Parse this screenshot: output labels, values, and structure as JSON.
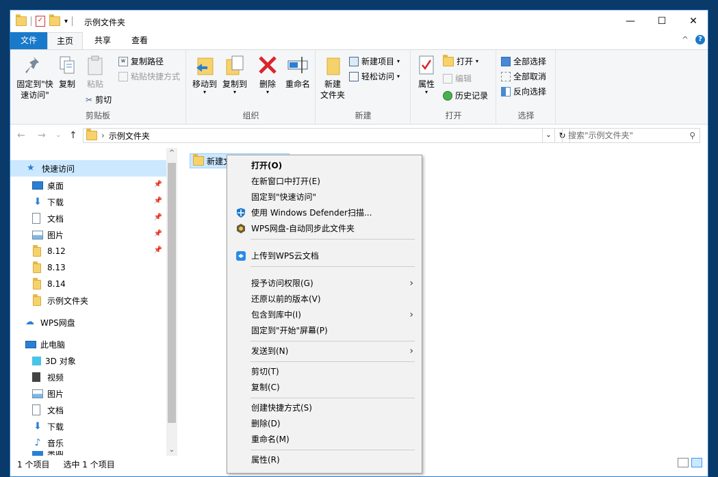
{
  "window": {
    "title": "示例文件夹",
    "qat_dropdown": "▾",
    "minimize": "—",
    "maximize": "☐",
    "close": "✕"
  },
  "tabs": {
    "file": "文件",
    "home": "主页",
    "share": "共享",
    "view": "查看",
    "collapse": "^",
    "help": "?"
  },
  "ribbon": {
    "clipboard": {
      "label": "剪贴板",
      "pin_quick": "固定到\"快速访问\"",
      "copy": "复制",
      "paste": "粘贴",
      "copy_path": "复制路径",
      "paste_shortcut": "粘贴快捷方式",
      "cut": "剪切"
    },
    "organize": {
      "label": "组织",
      "move_to": "移动到",
      "copy_to": "复制到",
      "delete": "删除",
      "rename": "重命名"
    },
    "new": {
      "label": "新建",
      "new_folder": "新建\n文件夹",
      "new_item": "新建项目",
      "easy_access": "轻松访问"
    },
    "open": {
      "label": "打开",
      "properties": "属性",
      "open": "打开",
      "edit": "编辑",
      "history": "历史记录"
    },
    "select": {
      "label": "选择",
      "select_all": "全部选择",
      "select_none": "全部取消",
      "invert": "反向选择"
    }
  },
  "address": {
    "back": "←",
    "forward": "→",
    "recent": "⌄",
    "up": "↑",
    "path": "示例文件夹",
    "chevron": "›",
    "dropdown": "⌄",
    "refresh": "↻",
    "search_placeholder": "搜索\"示例文件夹\""
  },
  "nav": {
    "quick_access": "快速访问",
    "items": [
      {
        "label": "桌面",
        "pinned": true
      },
      {
        "label": "下载",
        "pinned": true
      },
      {
        "label": "文档",
        "pinned": true
      },
      {
        "label": "图片",
        "pinned": true
      },
      {
        "label": "8.12",
        "pinned": true
      },
      {
        "label": "8.13",
        "pinned": false
      },
      {
        "label": "8.14",
        "pinned": false
      },
      {
        "label": "示例文件夹",
        "pinned": false
      }
    ],
    "wps": "WPS网盘",
    "this_pc": "此电脑",
    "pc_items": [
      "3D 对象",
      "视频",
      "图片",
      "文档",
      "下载",
      "音乐"
    ],
    "partial_item": "桌面",
    "scroll_up": "^",
    "scroll_down": "⌄"
  },
  "files": [
    {
      "name": "新建文"
    }
  ],
  "status": {
    "count": "1 个项目",
    "selected": "选中 1 个项目"
  },
  "context_menu": [
    {
      "label": "打开(O)",
      "bold": true
    },
    {
      "label": "在新窗口中打开(E)"
    },
    {
      "label": "固定到\"快速访问\""
    },
    {
      "label": "使用 Windows Defender扫描...",
      "icon": "defender-shield-icon"
    },
    {
      "label": "WPS网盘-自动同步此文件夹",
      "icon": "wps-sync-icon"
    },
    {
      "label": "上传到WPS云文档",
      "icon": "wps-cloud-icon"
    },
    {
      "label": "授予访问权限(G)",
      "submenu": true
    },
    {
      "label": "还原以前的版本(V)"
    },
    {
      "label": "包含到库中(I)",
      "submenu": true
    },
    {
      "label": "固定到\"开始\"屏幕(P)"
    },
    {
      "label": "发送到(N)",
      "submenu": true
    },
    {
      "label": "剪切(T)"
    },
    {
      "label": "复制(C)"
    },
    {
      "label": "创建快捷方式(S)"
    },
    {
      "label": "删除(D)"
    },
    {
      "label": "重命名(M)"
    },
    {
      "label": "属性(R)"
    }
  ],
  "colors": {
    "accent": "#1979ca",
    "selection": "#cce8ff",
    "folder": "#f6d26b"
  }
}
